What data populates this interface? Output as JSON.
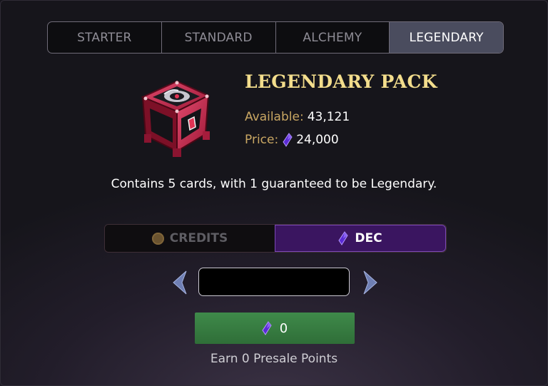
{
  "tabs": [
    {
      "label": "STARTER"
    },
    {
      "label": "STANDARD"
    },
    {
      "label": "ALCHEMY"
    },
    {
      "label": "LEGENDARY",
      "active": true
    }
  ],
  "pack": {
    "title": "LEGENDARY PACK",
    "available_label": "Available:",
    "available_value": "43,121",
    "price_label": "Price:",
    "price_value": "24,000",
    "price_icon": "dec-gem-icon",
    "description": "Contains 5 cards, with 1 guaranteed to be Legendary."
  },
  "currency": {
    "options": [
      {
        "label": "CREDITS",
        "icon": "credits-coin-icon",
        "selected": false
      },
      {
        "label": "DEC",
        "icon": "dec-gem-icon",
        "selected": true
      }
    ]
  },
  "quantity": {
    "value": ""
  },
  "buy": {
    "amount": "0",
    "icon": "dec-gem-icon"
  },
  "presale": {
    "text": "Earn 0 Presale Points"
  },
  "colors": {
    "title_gold": "#f3dd8c",
    "label_gold": "#c9a763",
    "active_tab": "#4a4c5e",
    "dec_selected": "#3a1560",
    "buy_green": "#3f8a4a"
  }
}
